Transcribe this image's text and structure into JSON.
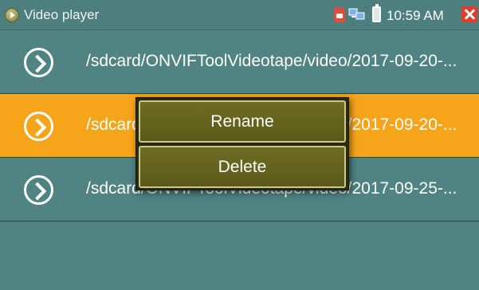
{
  "titlebar": {
    "app_icon": "play-circle-icon",
    "title": "Video player",
    "status": {
      "sd_icon": "sd-card-icon",
      "network_icon": "network-icon",
      "battery_icon": "battery-icon",
      "time": "10:59 AM",
      "close_icon": "close-icon"
    }
  },
  "files": [
    {
      "icon": "play-circle-icon",
      "path": "/sdcard/ONVIFToolVideotape/video/2017-09-20-..."
    },
    {
      "icon": "play-circle-icon",
      "path": "/sdcard/ONVIFToolVideotape/video/2017-09-20-...",
      "selected": true
    },
    {
      "icon": "play-circle-icon",
      "path": "/sdcard/ONVIFToolVideotape/video/2017-09-25-..."
    }
  ],
  "context_menu": {
    "items": [
      {
        "label": "Rename"
      },
      {
        "label": "Delete"
      }
    ]
  },
  "colors": {
    "background": "#4f8483",
    "selected_row": "#f6a51b",
    "menu_item": "#6f6d22",
    "close": "#e33a2b"
  }
}
